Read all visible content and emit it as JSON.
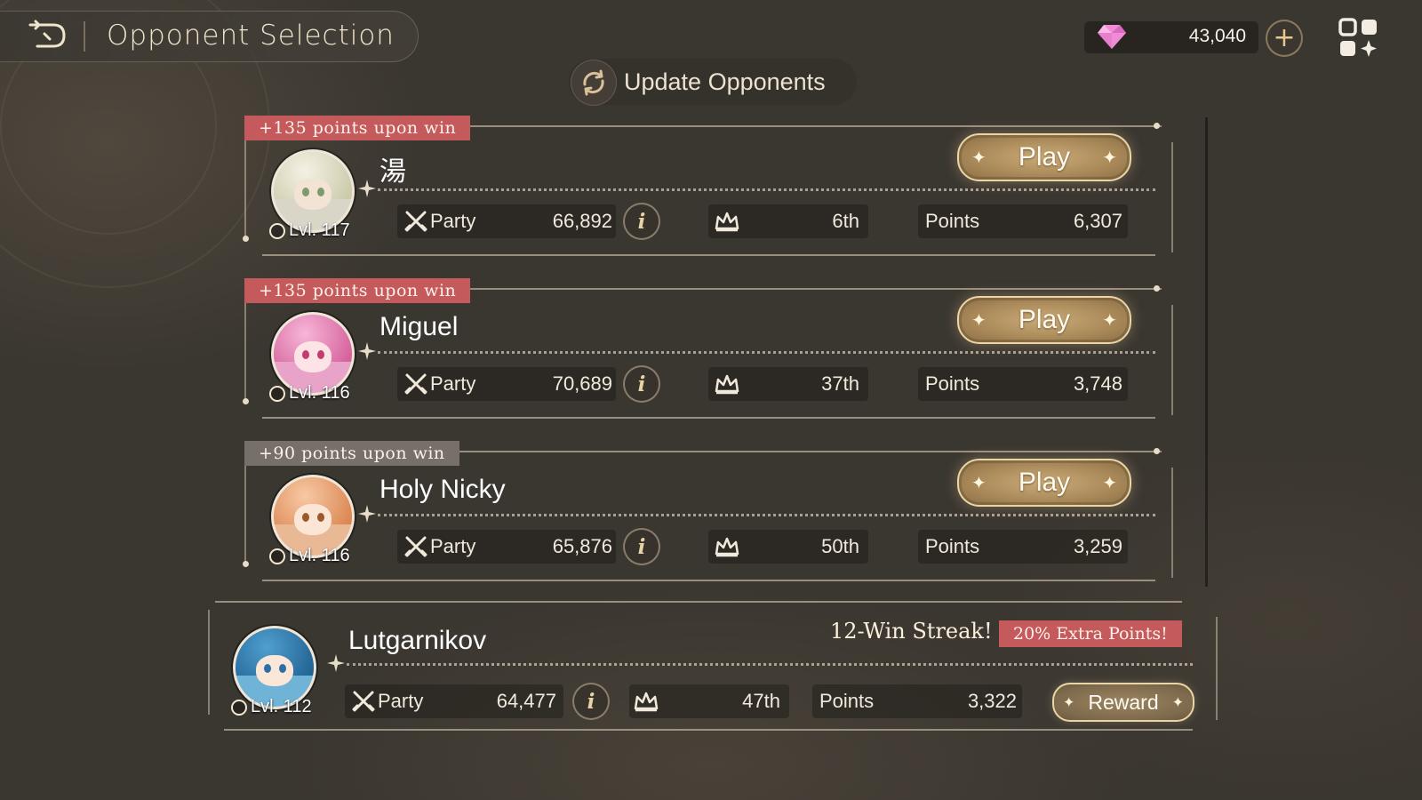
{
  "header": {
    "title": "Opponent Selection",
    "gems": "43,040"
  },
  "update": {
    "label": "Update Opponents"
  },
  "labels": {
    "party": "Party",
    "points": "Points",
    "play": "Play",
    "reward": "Reward"
  },
  "opponents": [
    {
      "bonus": "+135 points upon win",
      "name": "湯",
      "level": "Lvl. 117",
      "party": "66,892",
      "rank": "6th",
      "points": "6,307",
      "tag_color": "#c55a5d"
    },
    {
      "bonus": "+135 points upon win",
      "name": "Miguel",
      "level": "Lvl. 116",
      "party": "70,689",
      "rank": "37th",
      "points": "3,748",
      "tag_color": "#c55a5d"
    },
    {
      "bonus": "+90 points upon win",
      "name": "Holy Nicky",
      "level": "Lvl. 116",
      "party": "65,876",
      "rank": "50th",
      "points": "3,259",
      "tag_color": "#77706a"
    }
  ],
  "player": {
    "name": "Lutgarnikov",
    "level": "Lvl. 112",
    "party": "64,477",
    "rank": "47th",
    "points": "3,322",
    "streak": "12-Win Streak!",
    "extra": "20% Extra Points!"
  }
}
